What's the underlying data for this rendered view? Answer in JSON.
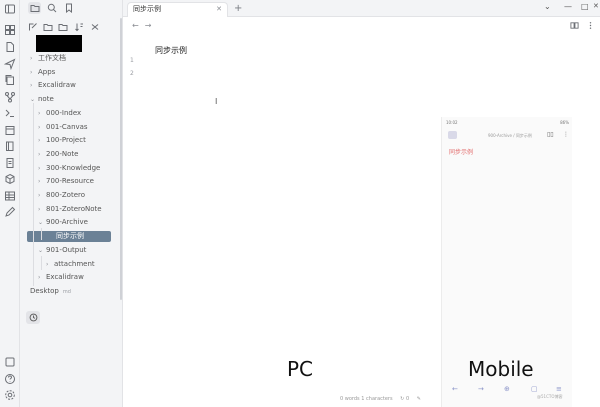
{
  "editor": {
    "tab_title": "同步示例",
    "note_title": "同步示例",
    "line_numbers": [
      "1",
      "2"
    ],
    "status": "0 words 1 characters"
  },
  "sidebar": {
    "tree": [
      {
        "label": "工作文档",
        "depth": 0,
        "open": false
      },
      {
        "label": "Apps",
        "depth": 0,
        "open": false
      },
      {
        "label": "Excalidraw",
        "depth": 0,
        "open": false
      },
      {
        "label": "note",
        "depth": 0,
        "open": true
      },
      {
        "label": "000-Index",
        "depth": 1,
        "open": false
      },
      {
        "label": "001-Canvas",
        "depth": 1,
        "open": false
      },
      {
        "label": "100-Project",
        "depth": 1,
        "open": false
      },
      {
        "label": "200-Note",
        "depth": 1,
        "open": false
      },
      {
        "label": "300-Knowledge",
        "depth": 1,
        "open": false
      },
      {
        "label": "700-Resource",
        "depth": 1,
        "open": false
      },
      {
        "label": "800-Zotero",
        "depth": 1,
        "open": false
      },
      {
        "label": "801-ZoteroNote",
        "depth": 1,
        "open": false
      },
      {
        "label": "900-Archive",
        "depth": 1,
        "open": true
      },
      {
        "label": "同步示例",
        "depth": 2,
        "file": true,
        "selected": true
      },
      {
        "label": "901-Output",
        "depth": 1,
        "open": true
      },
      {
        "label": "attachment",
        "depth": 2,
        "open": false
      },
      {
        "label": "Excalidraw",
        "depth": 1,
        "open": false
      },
      {
        "label": "Desktop",
        "depth": 0,
        "file": true,
        "badge": "md"
      }
    ]
  },
  "mobile": {
    "time": "10:02",
    "battery": "86%",
    "breadcrumb": "900-Archive / 同步示例",
    "note_title": "同步示例",
    "watermark": "@51CTO博客"
  },
  "labels": {
    "pc": "PC",
    "mobile": "Mobile"
  }
}
